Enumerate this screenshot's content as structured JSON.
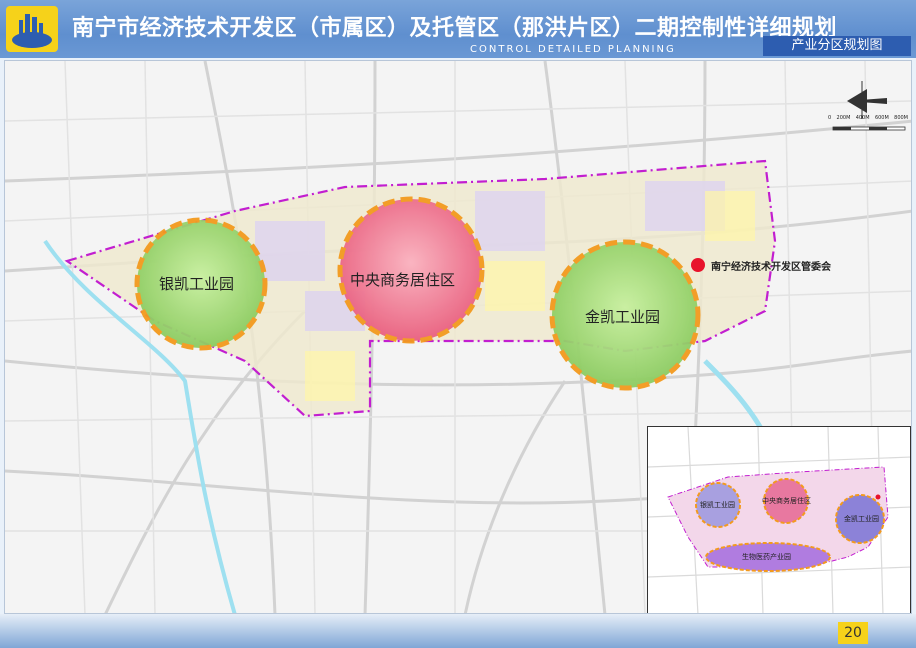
{
  "header": {
    "title": "南宁市经济技术开发区（市属区）及托管区（那洪片区）二期控制性详细规划",
    "subtitle": "CONTROL DETAILED PLANNING",
    "section": "产业分区规划图"
  },
  "map": {
    "zones": [
      {
        "label": "银凯工业园",
        "color": "#9fd86f"
      },
      {
        "label": "中央商务居住区",
        "color": "#f0708f"
      },
      {
        "label": "金凯工业园",
        "color": "#9fd86f"
      }
    ],
    "landmark": {
      "label": "南宁经济技术开发区管委会",
      "color": "#e8132b"
    },
    "scale": {
      "ticks": [
        "0",
        "200M",
        "400M",
        "600M",
        "800M"
      ]
    }
  },
  "inset": {
    "zones": [
      "银凯工业园",
      "中央商务居住区",
      "金凯工业园",
      "生物医药产业园"
    ]
  },
  "footer": {
    "page": "20"
  }
}
